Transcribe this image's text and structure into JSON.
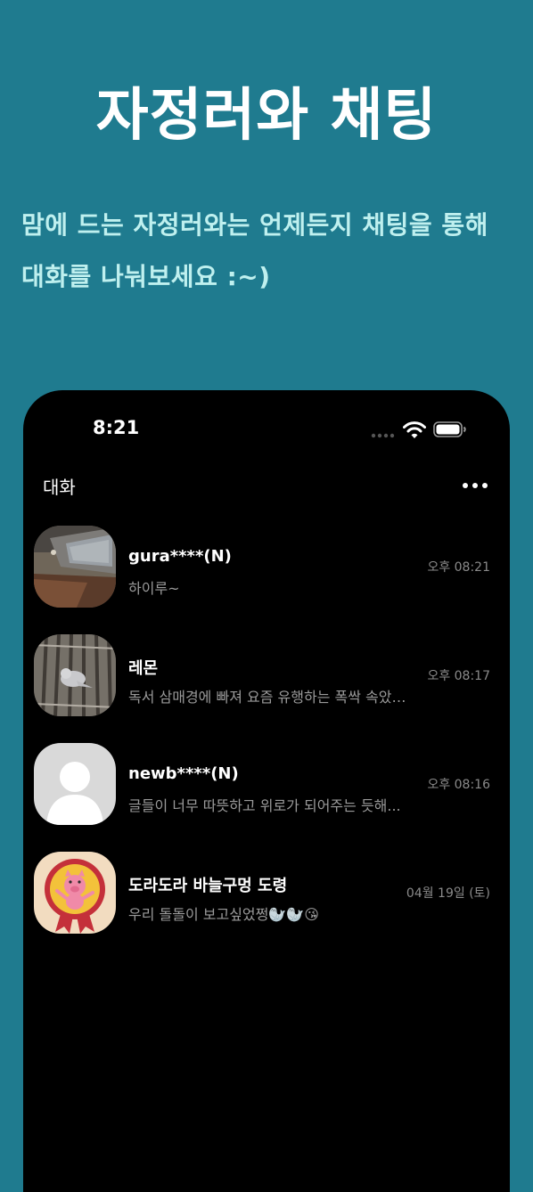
{
  "promo": {
    "title": "자정러와 채팅",
    "subtitle": "맘에 드는 자정러와는 언제든지 채팅을 통해 대화를 나눠보세요 :~)"
  },
  "status_bar": {
    "time": "8:21",
    "icons": [
      "signal-dots-icon",
      "wifi-icon",
      "battery-icon"
    ]
  },
  "nav": {
    "title": "대화",
    "more_icon": "ellipsis-icon"
  },
  "chats": [
    {
      "name": "gura****(N)",
      "time": "오후 08:21",
      "preview": "하이루~",
      "avatar": "photo-laptop-avatar"
    },
    {
      "name": "레몬",
      "time": "오후 08:17",
      "preview": "독서 삼매경에 빠져 요즘 유행하는 폭싹 속았…",
      "avatar": "photo-bird-cage-avatar"
    },
    {
      "name": "newb****(N)",
      "time": "오후 08:16",
      "preview": "글들이 너무 따뜻하고 위로가 되어주는 듯해...",
      "avatar": "default-person-avatar"
    },
    {
      "name": "도라도라 바늘구멍 도령",
      "time": "04월 19일 (토)",
      "preview": "우리 돌돌이 보고싶었쩡🦭🦭😘",
      "avatar": "pig-badge-avatar"
    }
  ],
  "colors": {
    "background": "#1f7b8f",
    "subtitle": "#bff0ef",
    "phone_background": "#000000"
  }
}
